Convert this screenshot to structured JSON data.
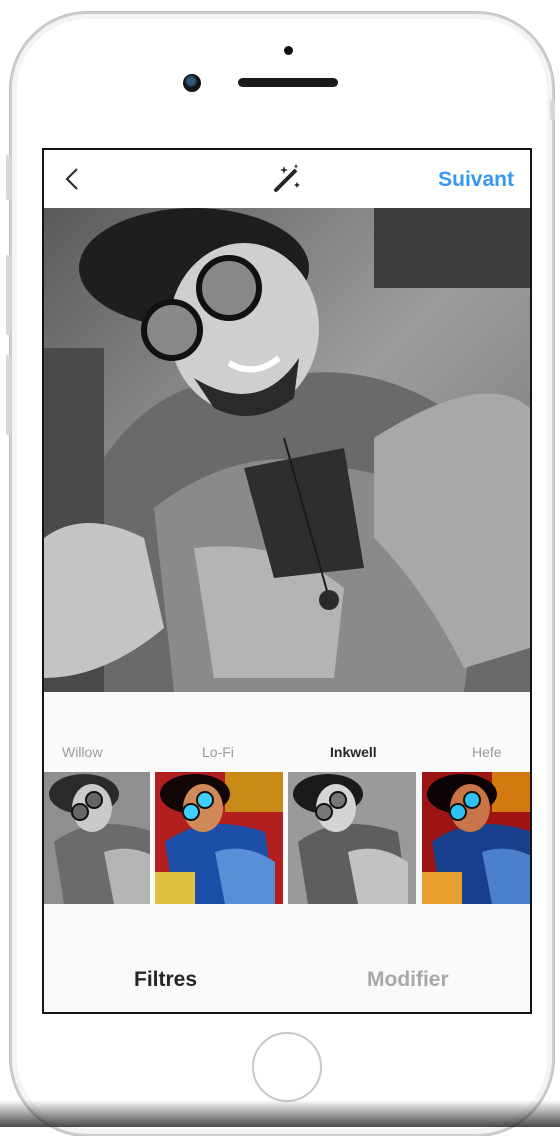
{
  "header": {
    "back_icon": "chevron-left-icon",
    "tool_icon": "magic-wand-icon",
    "next_label": "Suivant",
    "accent_color": "#3897f0"
  },
  "filters": [
    {
      "name": "Willow",
      "style": "grayscale",
      "active": false
    },
    {
      "name": "Lo-Fi",
      "style": "vivid",
      "active": false
    },
    {
      "name": "Inkwell",
      "style": "grayscale",
      "active": true
    },
    {
      "name": "Hefe",
      "style": "vivid",
      "active": false
    }
  ],
  "tabs": {
    "filters_label": "Filtres",
    "edit_label": "Modifier",
    "active_tab": "Filtres"
  }
}
